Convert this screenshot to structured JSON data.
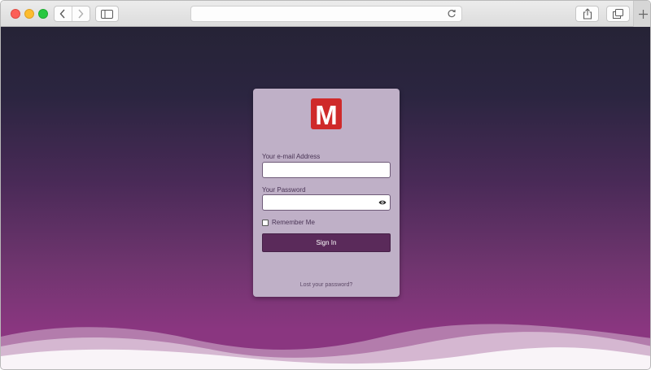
{
  "browser": {
    "address_text": "",
    "colors": {
      "close": "#fc5f57",
      "minimize": "#fdbc2e",
      "maximize": "#28c840"
    }
  },
  "login": {
    "logo_letter": "M",
    "email_label": "Your e-mail Address",
    "email_value": "",
    "password_label": "Your Password",
    "password_value": "",
    "remember_label": "Remember Me",
    "remember_checked": false,
    "signin_label": "Sign In",
    "lost_password_label": "Lost your password?",
    "colors": {
      "logo": "#cf2a2a",
      "button": "#5a2a5a",
      "card": "#bfb0c7"
    }
  }
}
